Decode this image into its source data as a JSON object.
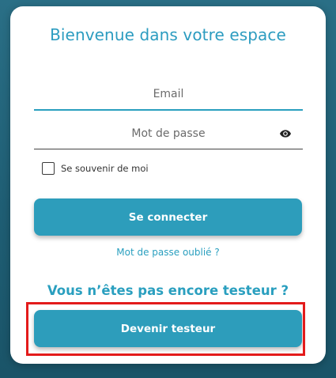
{
  "login": {
    "title": "Bienvenue dans votre espace",
    "email": {
      "placeholder": "Email",
      "value": ""
    },
    "password": {
      "placeholder": "Mot de passe",
      "value": "",
      "toggle_icon": "eye-icon"
    },
    "remember": {
      "label": "Se souvenir de moi",
      "checked": false
    },
    "submit_label": "Se connecter",
    "forgot_label": "Mot de passe oublié ?"
  },
  "signup": {
    "prompt": "Vous n’êtes pas encore testeur ?",
    "button_label": "Devenir testeur"
  },
  "colors": {
    "accent": "#2d9dbb",
    "highlight": "#e31b1b"
  }
}
